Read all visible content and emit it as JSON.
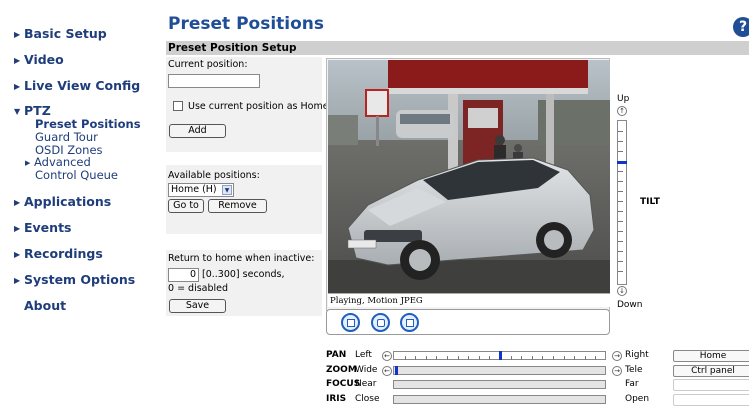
{
  "sidebar": {
    "items": [
      {
        "label": "Basic Setup"
      },
      {
        "label": "Video"
      },
      {
        "label": "Live View Config"
      },
      {
        "label": "PTZ"
      },
      {
        "label": "Applications"
      },
      {
        "label": "Events"
      },
      {
        "label": "Recordings"
      },
      {
        "label": "System Options"
      },
      {
        "label": "About"
      }
    ],
    "ptz_sub": {
      "preset_positions": "Preset Positions",
      "guard_tour": "Guard Tour",
      "osdi_zones": "OSDI Zones",
      "advanced": "Advanced",
      "control_queue": "Control Queue"
    }
  },
  "header": {
    "title": "Preset Positions",
    "help_icon": "question-mark-icon",
    "section": "Preset Position Setup"
  },
  "form": {
    "current_position_label": "Current position:",
    "current_position_value": "",
    "use_as_home_label": "Use current position as Home",
    "add_label": "Add",
    "available_positions_label": "Available positions:",
    "selected_position": "Home (H)",
    "goto_label": "Go to",
    "remove_label": "Remove",
    "return_home_label": "Return to home when inactive:",
    "return_home_value": "0",
    "return_home_range": "[0..300] seconds,",
    "disabled_note": "0 = disabled",
    "save_label": "Save"
  },
  "video": {
    "status_text": "Playing, Motion JPEG",
    "colors": {
      "accent": "#1e5fbf",
      "thumb": "#1034c9"
    }
  },
  "tilt": {
    "up_label": "Up",
    "down_label": "Down",
    "name": "TILT",
    "level": 0.25
  },
  "ptz_rows": [
    {
      "name": "PAN",
      "left": "Left",
      "right": "Right",
      "button": "Home",
      "level": 0.5
    },
    {
      "name": "ZOOM",
      "left": "Wide",
      "right": "Tele",
      "button": "Ctrl panel",
      "level": 0.0
    },
    {
      "name": "FOCUS",
      "left": "Near",
      "right": "Far",
      "button": ""
    },
    {
      "name": "IRIS",
      "left": "Close",
      "right": "Open",
      "button": ""
    }
  ]
}
